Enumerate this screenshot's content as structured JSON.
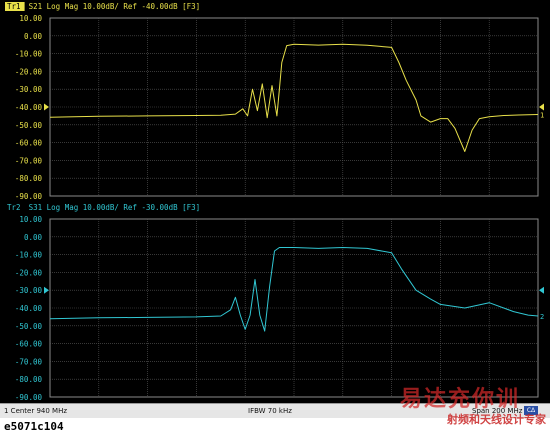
{
  "colors": {
    "trace1": "#e8e04a",
    "trace2": "#31c7d3",
    "grid": "#5a5a5a",
    "background": "#000000"
  },
  "caption": "e5071c104",
  "status_bar": {
    "left": "1  Center 940 MHz",
    "middle": "IFBW 70 kHz",
    "right": "Span 200 MHz",
    "badge": "CΔ"
  },
  "watermark": {
    "big": "易达充你训",
    "small": "射频和天线设计专家"
  },
  "chart_data": [
    {
      "type": "line",
      "title_tag": "Tr1",
      "title": "S21 Log Mag 10.00dB/ Ref -40.00dB [F3]",
      "y_tick_labels": [
        "10.00",
        "0.00",
        "-10.00",
        "-20.00",
        "-30.00",
        "-40.00",
        "-50.00",
        "-60.00",
        "-70.00",
        "-80.00",
        "-90.00"
      ],
      "ylim": [
        -90,
        10
      ],
      "reference_level": -40,
      "trace_end_label": "1",
      "x_divisions": 10,
      "grid": true,
      "series": [
        {
          "color": "#e8e04a",
          "x": [
            0,
            10,
            20,
            30,
            35,
            38,
            39.5,
            40.5,
            41.5,
            42.5,
            43.5,
            44.5,
            45.5,
            46.5,
            47,
            47.5,
            48.5,
            50,
            55,
            60,
            65,
            70,
            71.5,
            73,
            75,
            76,
            78,
            80,
            81.5,
            83,
            85,
            86.5,
            88,
            90,
            93,
            96,
            100
          ],
          "y": [
            -45.8,
            -45.2,
            -45.0,
            -44.8,
            -44.6,
            -44.0,
            -41,
            -45,
            -30,
            -42,
            -27,
            -46,
            -28,
            -45,
            -30,
            -15,
            -5.5,
            -4.8,
            -5.2,
            -4.8,
            -5.3,
            -6.5,
            -15,
            -25,
            -36,
            -45,
            -48.5,
            -46.5,
            -46.5,
            -52,
            -65,
            -53,
            -46.5,
            -45.5,
            -44.8,
            -44.5,
            -44.2
          ]
        }
      ]
    },
    {
      "type": "line",
      "title_tag": "Tr2",
      "title": "S31 Log Mag 10.00dB/ Ref -30.00dB [F3]",
      "y_tick_labels": [
        "10.00",
        "0.00",
        "-10.00",
        "-20.00",
        "-30.00",
        "-40.00",
        "-50.00",
        "-60.00",
        "-70.00",
        "-80.00",
        "-90.00"
      ],
      "ylim": [
        -90,
        10
      ],
      "reference_level": -30,
      "trace_end_label": "2",
      "x_divisions": 10,
      "grid": true,
      "series": [
        {
          "color": "#31c7d3",
          "x": [
            0,
            10,
            20,
            30,
            35,
            37,
            38,
            39,
            40,
            41,
            42,
            43,
            44,
            45,
            46,
            47,
            48,
            50,
            55,
            60,
            65,
            70,
            72,
            75,
            78,
            80,
            85,
            90,
            95,
            98,
            100
          ],
          "y": [
            -46,
            -45.5,
            -45.3,
            -45,
            -44.5,
            -41,
            -34,
            -44,
            -52,
            -44,
            -24,
            -44,
            -53,
            -28,
            -8,
            -6,
            -6,
            -6,
            -6.5,
            -6,
            -6.5,
            -9,
            -18,
            -30,
            -35,
            -38,
            -40,
            -37,
            -42,
            -44,
            -44.5
          ]
        }
      ]
    }
  ]
}
